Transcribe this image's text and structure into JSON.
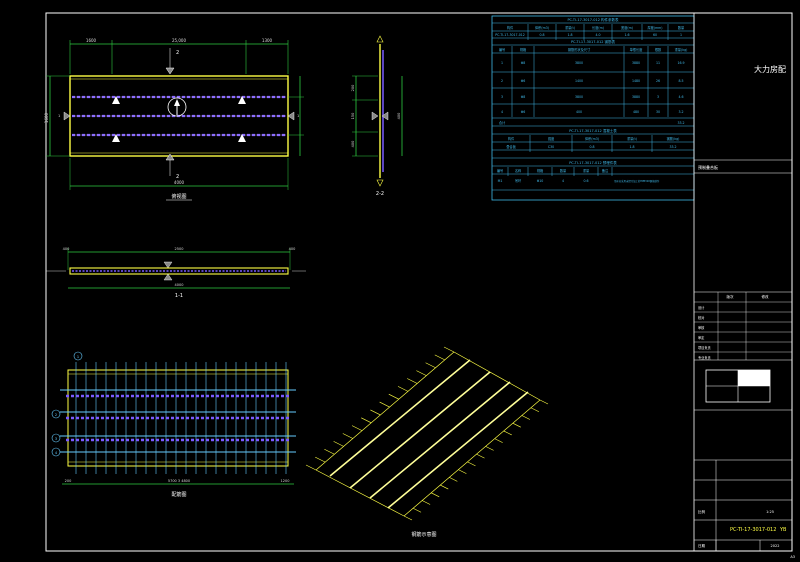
{
  "drawing": {
    "code": "PC-TI-17-3017-012",
    "code_suffix": "YB",
    "sheet_no": "A3"
  },
  "plan_view": {
    "dims_top": [
      "1600",
      "25,000",
      "1300"
    ],
    "dim_bottom": "4000",
    "dim_left": "1600",
    "section_mark": "2",
    "caption": "俯视图"
  },
  "side_view": {
    "dims_top": [
      "400",
      "2500",
      "400"
    ],
    "dim_bottom": "4000",
    "caption": "1-1"
  },
  "end_view": {
    "dims_left": [
      "200",
      "150",
      "400"
    ],
    "dim_right": "400",
    "caption": "2-2"
  },
  "rebar_view": {
    "labels": [
      "1",
      "2",
      "3",
      "4"
    ],
    "dims_bottom": [
      "200",
      "5700 3 4800",
      "1200"
    ],
    "caption": "配筋图"
  },
  "iso_view": {
    "caption": "钢筋示意图"
  },
  "table1": {
    "title": "PC-TI-17-3017-012 构件参数表",
    "header": [
      "构件",
      "体积(m3)",
      "重量(t)",
      "长度(m)",
      "宽度(m)",
      "厚度(mm)",
      "数量"
    ],
    "row": [
      "PC-TI-17-3017-012",
      "0.8",
      "1.8",
      "4.0",
      "1.6",
      "60",
      "1"
    ]
  },
  "table2": {
    "title": "PC-TI-17-3017-012 钢筋表",
    "header": [
      "编号",
      "规格",
      "钢筋形状及尺寸",
      "单根长度",
      "根数",
      "重量(kg)"
    ],
    "rows": [
      [
        "1",
        "Φ8",
        "3800",
        "3880",
        "11",
        "16.9"
      ],
      [
        "2",
        "Φ6",
        "1400",
        "1480",
        "26",
        "8.5"
      ],
      [
        "3",
        "Φ8",
        "3800",
        "3880",
        "3",
        "4.6"
      ],
      [
        "4",
        "Φ6",
        "400",
        "480",
        "30",
        "3.2"
      ]
    ],
    "total_label": "合计",
    "total_value": "33.2"
  },
  "table3": {
    "title": "PC-TI-17-3017-012 混凝土表",
    "header": [
      "构件",
      "强度",
      "体积(m3)",
      "重量(t)",
      "钢筋(kg)"
    ],
    "row": [
      "叠合板",
      "C30",
      "0.8",
      "1.8",
      "33.2"
    ]
  },
  "table4": {
    "title": "PC-TI-17-3017-012 预埋件表",
    "header": [
      "编号",
      "名称",
      "规格",
      "数量",
      "重量",
      "备注"
    ],
    "row": [
      "M1",
      "吊环",
      "Φ10",
      "4",
      "0.6",
      "吊环应采用未经冷加工的HPB300钢筋制作"
    ]
  },
  "title_block": {
    "company": "大力房配",
    "project": "预制叠合板",
    "rev_header": [
      "版次",
      "修改"
    ],
    "roles": [
      "设计",
      "校对",
      "审核",
      "审定",
      "项目负责",
      "专业负责"
    ],
    "scale_label": "比例",
    "scale_value": "1:25",
    "date_label": "日期",
    "date_value": "2022"
  }
}
